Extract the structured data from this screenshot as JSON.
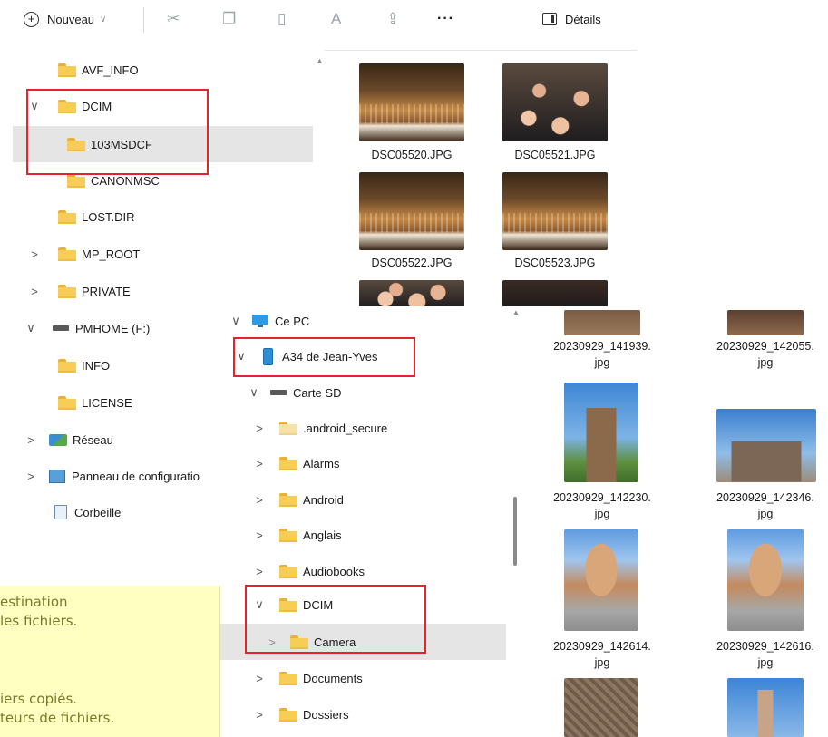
{
  "toolbar": {
    "new_label": "Nouveau",
    "details_label": "Détails",
    "more_label": "···"
  },
  "back_tree": [
    {
      "label": "AVF_INFO",
      "icon": "folder-icon",
      "chevron": ""
    },
    {
      "label": "DCIM",
      "icon": "folder-icon",
      "chevron": "∨"
    },
    {
      "label": "103MSDCF",
      "icon": "folder-icon",
      "chevron": ""
    },
    {
      "label": "CANONMSC",
      "icon": "folder-icon",
      "chevron": ""
    },
    {
      "label": "LOST.DIR",
      "icon": "folder-icon",
      "chevron": ""
    },
    {
      "label": "MP_ROOT",
      "icon": "folder-icon",
      "chevron": ">"
    },
    {
      "label": "PRIVATE",
      "icon": "folder-icon",
      "chevron": ">"
    },
    {
      "label": "PMHOME (F:)",
      "icon": "drive-icon",
      "chevron": "∨"
    },
    {
      "label": "INFO",
      "icon": "folder-icon",
      "chevron": ""
    },
    {
      "label": "LICENSE",
      "icon": "folder-icon",
      "chevron": ""
    },
    {
      "label": "Réseau",
      "icon": "network-icon",
      "chevron": ">"
    },
    {
      "label": "Panneau de configuratio",
      "icon": "control-panel-icon",
      "chevron": ">"
    },
    {
      "label": "Corbeille",
      "icon": "recycle-bin-icon",
      "chevron": ""
    }
  ],
  "back_files": [
    {
      "name": "DSC05520.JPG"
    },
    {
      "name": "DSC05521.JPG"
    },
    {
      "name": "DSC05522.JPG"
    },
    {
      "name": "DSC05523.JPG"
    }
  ],
  "front_tree": [
    {
      "label": "Ce PC",
      "icon": "pc-icon",
      "chevron": "∨"
    },
    {
      "label": "A34 de Jean-Yves",
      "icon": "phone-icon",
      "chevron": "∨"
    },
    {
      "label": "Carte SD",
      "icon": "drive-icon",
      "chevron": "∨"
    },
    {
      "label": ".android_secure",
      "icon": "folder-icon",
      "chevron": ">"
    },
    {
      "label": "Alarms",
      "icon": "folder-icon",
      "chevron": ">"
    },
    {
      "label": "Android",
      "icon": "folder-icon",
      "chevron": ">"
    },
    {
      "label": "Anglais",
      "icon": "folder-icon",
      "chevron": ">"
    },
    {
      "label": "Audiobooks",
      "icon": "folder-icon",
      "chevron": ">"
    },
    {
      "label": "DCIM",
      "icon": "folder-icon",
      "chevron": "∨"
    },
    {
      "label": "Camera",
      "icon": "folder-icon",
      "chevron": ">"
    },
    {
      "label": "Documents",
      "icon": "folder-icon",
      "chevron": ">"
    },
    {
      "label": "Dossiers",
      "icon": "folder-icon",
      "chevron": ">"
    }
  ],
  "front_files": [
    {
      "line1": "20230929_141939.",
      "line2": "jpg"
    },
    {
      "line1": "20230929_142055.",
      "line2": "jpg"
    },
    {
      "line1": "20230929_142230.",
      "line2": "jpg"
    },
    {
      "line1": "20230929_142346.",
      "line2": "jpg"
    },
    {
      "line1": "20230929_142614.",
      "line2": "jpg"
    },
    {
      "line1": "20230929_142616.",
      "line2": "jpg"
    }
  ],
  "note_lines": [
    "estination",
    "les fichiers.",
    "",
    "iers copiés.",
    "teurs de fichiers."
  ],
  "colors": {
    "highlight_border": "#e8222a",
    "selection_bg": "#e5e5e5",
    "note_bg": "#ffffc2",
    "folder": "#f7cd56"
  }
}
